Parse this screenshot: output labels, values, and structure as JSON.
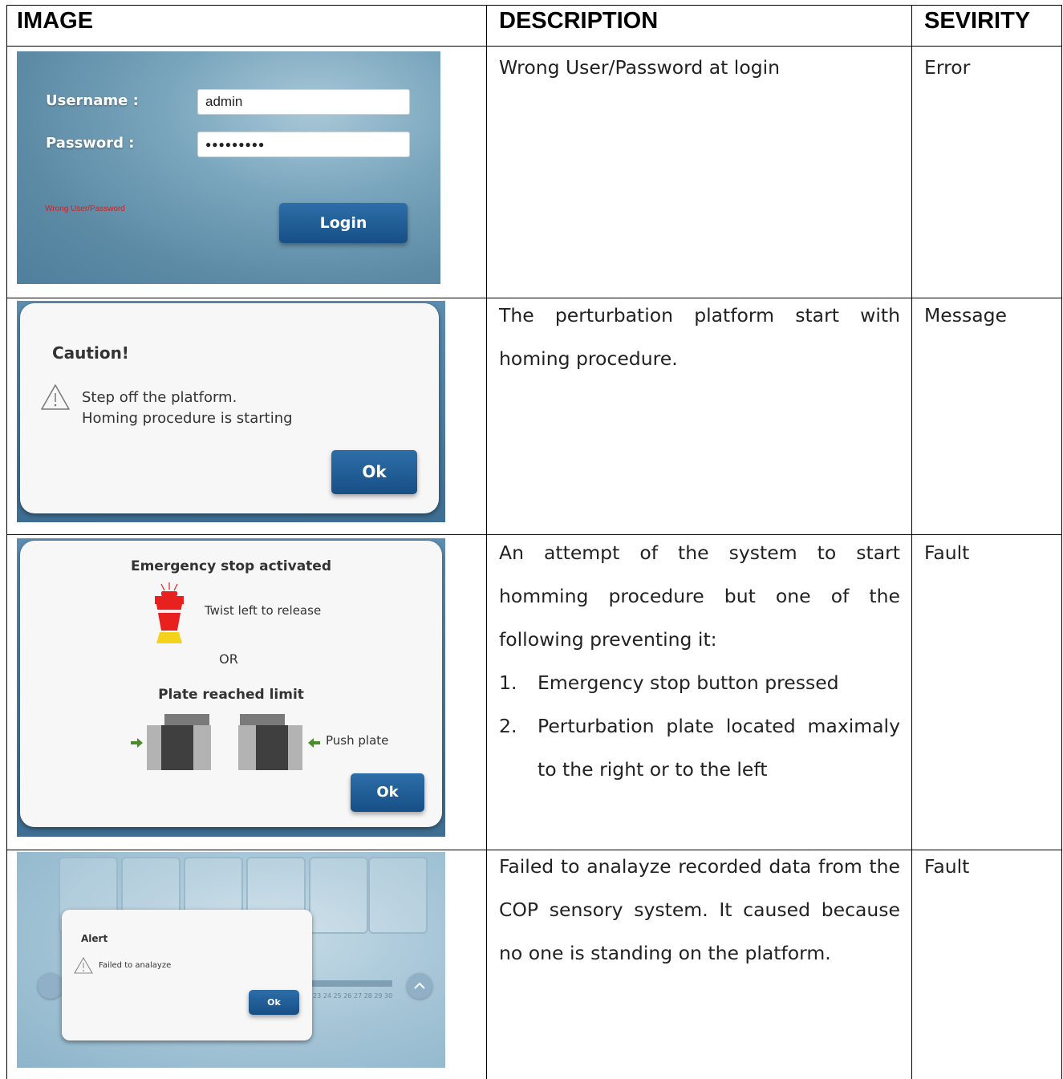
{
  "headers": {
    "image": "IMAGE",
    "description": "DESCRIPTION",
    "severity": "SEVIRITY"
  },
  "rows": [
    {
      "description": "Wrong User/Password at login",
      "severity": "Error",
      "screen": {
        "username_label": "Username :",
        "username_value": "admin",
        "password_label": "Password :",
        "password_value": "●●●●●●●●●",
        "error_text": "Wrong User/Password",
        "login_button": "Login"
      }
    },
    {
      "description": "The perturbation platform start with homing procedure.",
      "severity": "Message",
      "screen": {
        "title": "Caution!",
        "line1": "Step off the platform.",
        "line2": "Homing procedure is starting",
        "ok_button": "Ok"
      }
    },
    {
      "description_intro": "An attempt of the system to start homming procedure but one of the following preventing it:",
      "items": [
        {
          "num": "1.",
          "text": "Emergency stop button pressed"
        },
        {
          "num": "2.",
          "text": "Perturbation plate located maximaly to the right or to the left"
        }
      ],
      "severity": "Fault",
      "screen": {
        "title": "Emergency stop activated",
        "twist_text": "Twist left to release",
        "or_text": "OR",
        "plate_title": "Plate reached limit",
        "push_text": "Push plate",
        "ok_button": "Ok"
      }
    },
    {
      "description": "Failed to analayze recorded data from the COP sensory system. It caused because no one is standing on the platform.",
      "severity": "Fault",
      "screen": {
        "title": "Alert",
        "message": "Failed to analayze",
        "ok_button": "Ok",
        "scale_numbers": "23 24 25 26 27 28 29 30"
      }
    }
  ],
  "colors": {
    "button_blue": "#1d5a93",
    "error_red": "#d02020",
    "arrow_green": "#4a8c2a",
    "estop_red": "#e8201e",
    "estop_yellow": "#f2d21a"
  }
}
